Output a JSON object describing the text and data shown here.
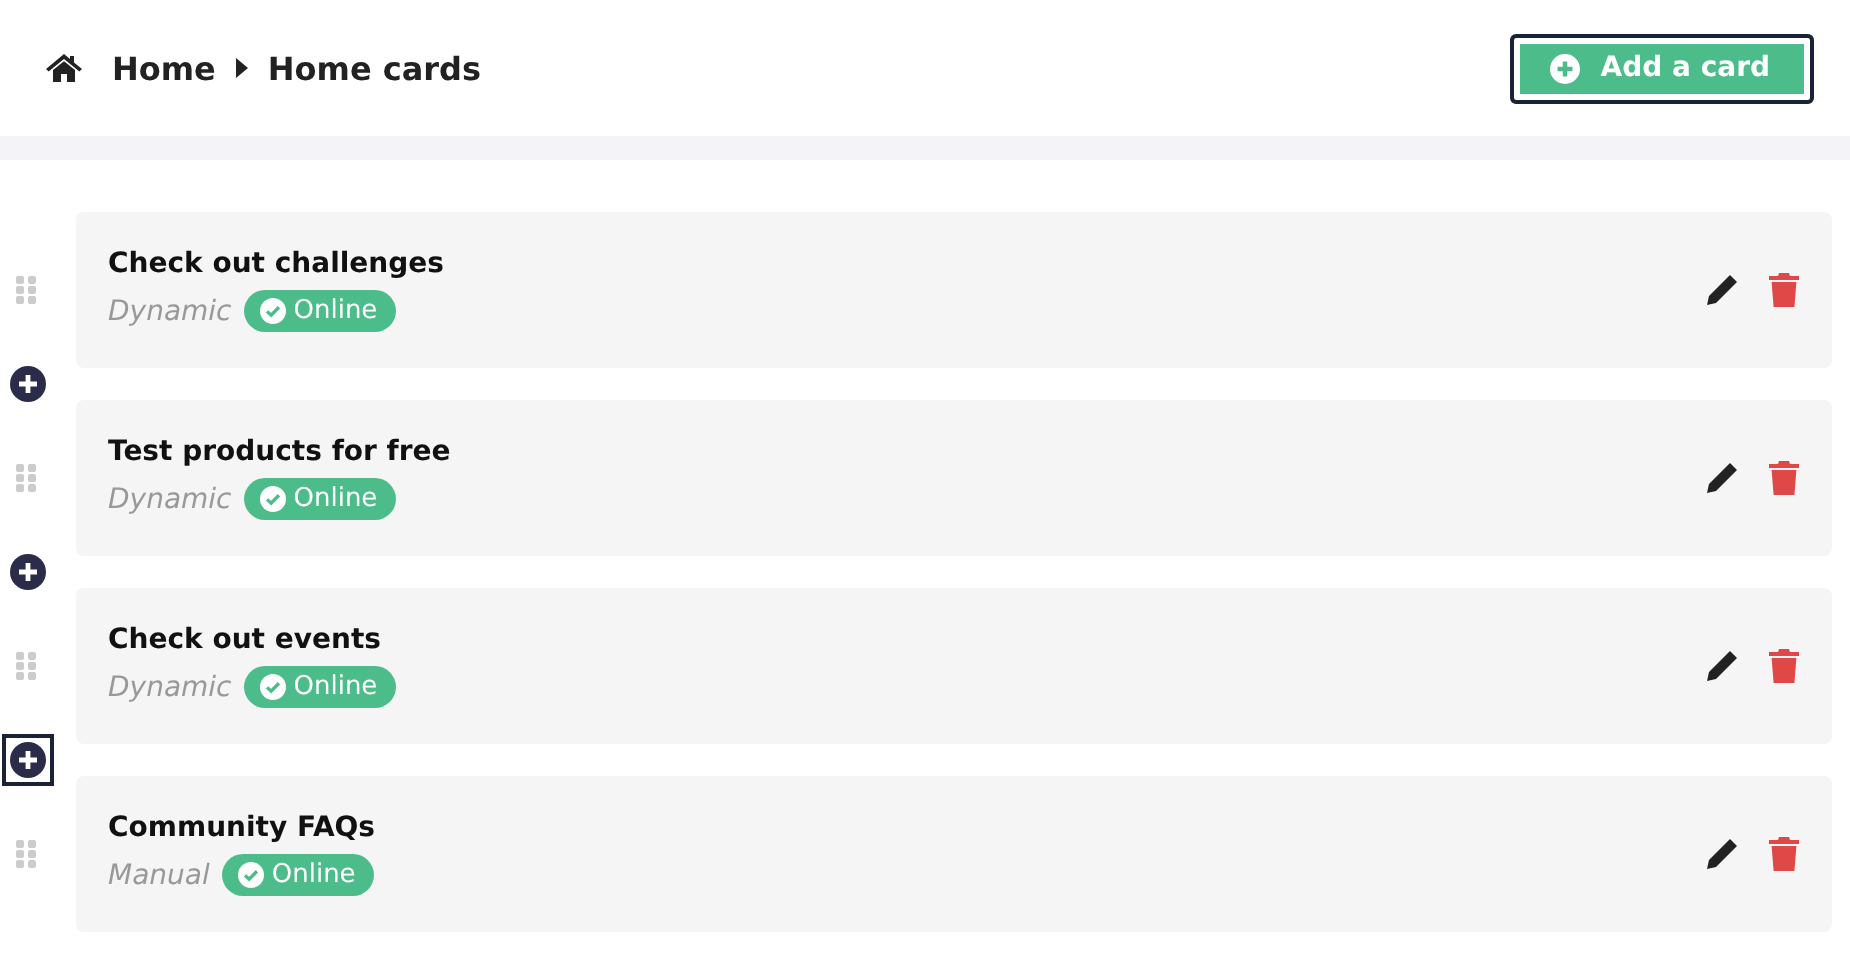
{
  "breadcrumb": [
    "Home",
    "Home cards"
  ],
  "add_button": {
    "label": "Add a card",
    "focused": true
  },
  "cards": [
    {
      "title": "Check out challenges",
      "type": "Dynamic",
      "status": {
        "label": "Online",
        "kind": "online"
      }
    },
    {
      "title": "Test products for free",
      "type": "Dynamic",
      "status": {
        "label": "Online",
        "kind": "online"
      }
    },
    {
      "title": "Check out events",
      "type": "Dynamic",
      "status": {
        "label": "Online",
        "kind": "online"
      }
    },
    {
      "title": "Community FAQs",
      "type": "Manual",
      "status": {
        "label": "Online",
        "kind": "online"
      }
    }
  ],
  "insert_buttons": [
    {
      "focused": false
    },
    {
      "focused": false
    },
    {
      "focused": true
    }
  ]
}
